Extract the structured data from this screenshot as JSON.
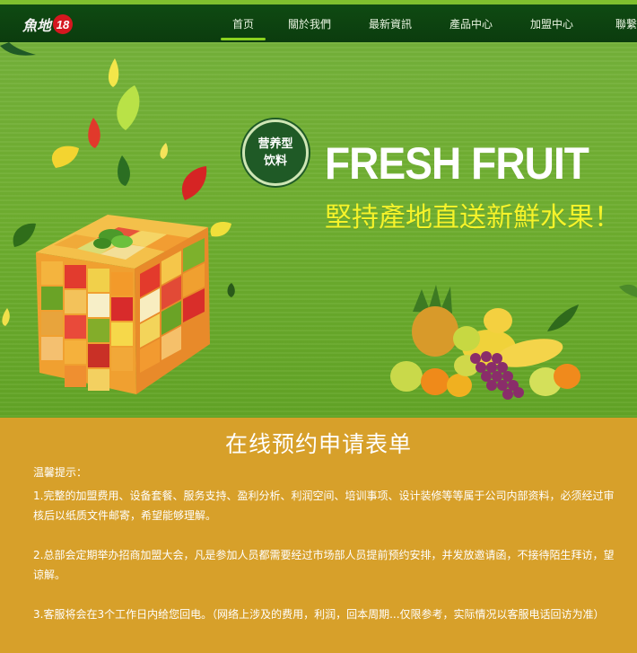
{
  "brand": {
    "logo_text": "魚地",
    "logo_badge": "18"
  },
  "nav": {
    "items": [
      {
        "label": "首页",
        "active": true
      },
      {
        "label": "關於我們",
        "active": false
      },
      {
        "label": "最新資訊",
        "active": false
      },
      {
        "label": "產品中心",
        "active": false
      },
      {
        "label": "加盟中心",
        "active": false
      },
      {
        "label": "聯繫我",
        "active": false
      }
    ]
  },
  "hero": {
    "bubble_line1": "营养型",
    "bubble_line2": "饮料",
    "headline": "FRESH FRUIT",
    "subheadline": "堅持產地直送新鮮水果！",
    "colors": {
      "background": "#6fae30",
      "headline": "#ffffff",
      "subheadline": "#f5f32a"
    }
  },
  "form": {
    "title": "在线预约申请表单",
    "notice_heading": "温馨提示：",
    "notices": [
      "1.完整的加盟费用、设备套餐、服务支持、盈利分析、利润空间、培训事项、设计装修等等属于公司内部资料，必须经过审核后以纸质文件邮寄，希望能够理解。",
      "2.总部会定期举办招商加盟大会，凡是参加人员都需要经过市场部人员提前预约安排，并发放邀请函，不接待陌生拜访，望谅解。",
      "3.客服将会在3个工作日内给您回电。（网络上涉及的费用，利润，回本周期...仅限参考，实际情况以客服电话回访为准）"
    ],
    "colors": {
      "background": "#d7a02a",
      "text": "#ffffff"
    }
  },
  "colors": {
    "nav": "#0d4310",
    "nav_active_underline": "#8bd21f"
  }
}
